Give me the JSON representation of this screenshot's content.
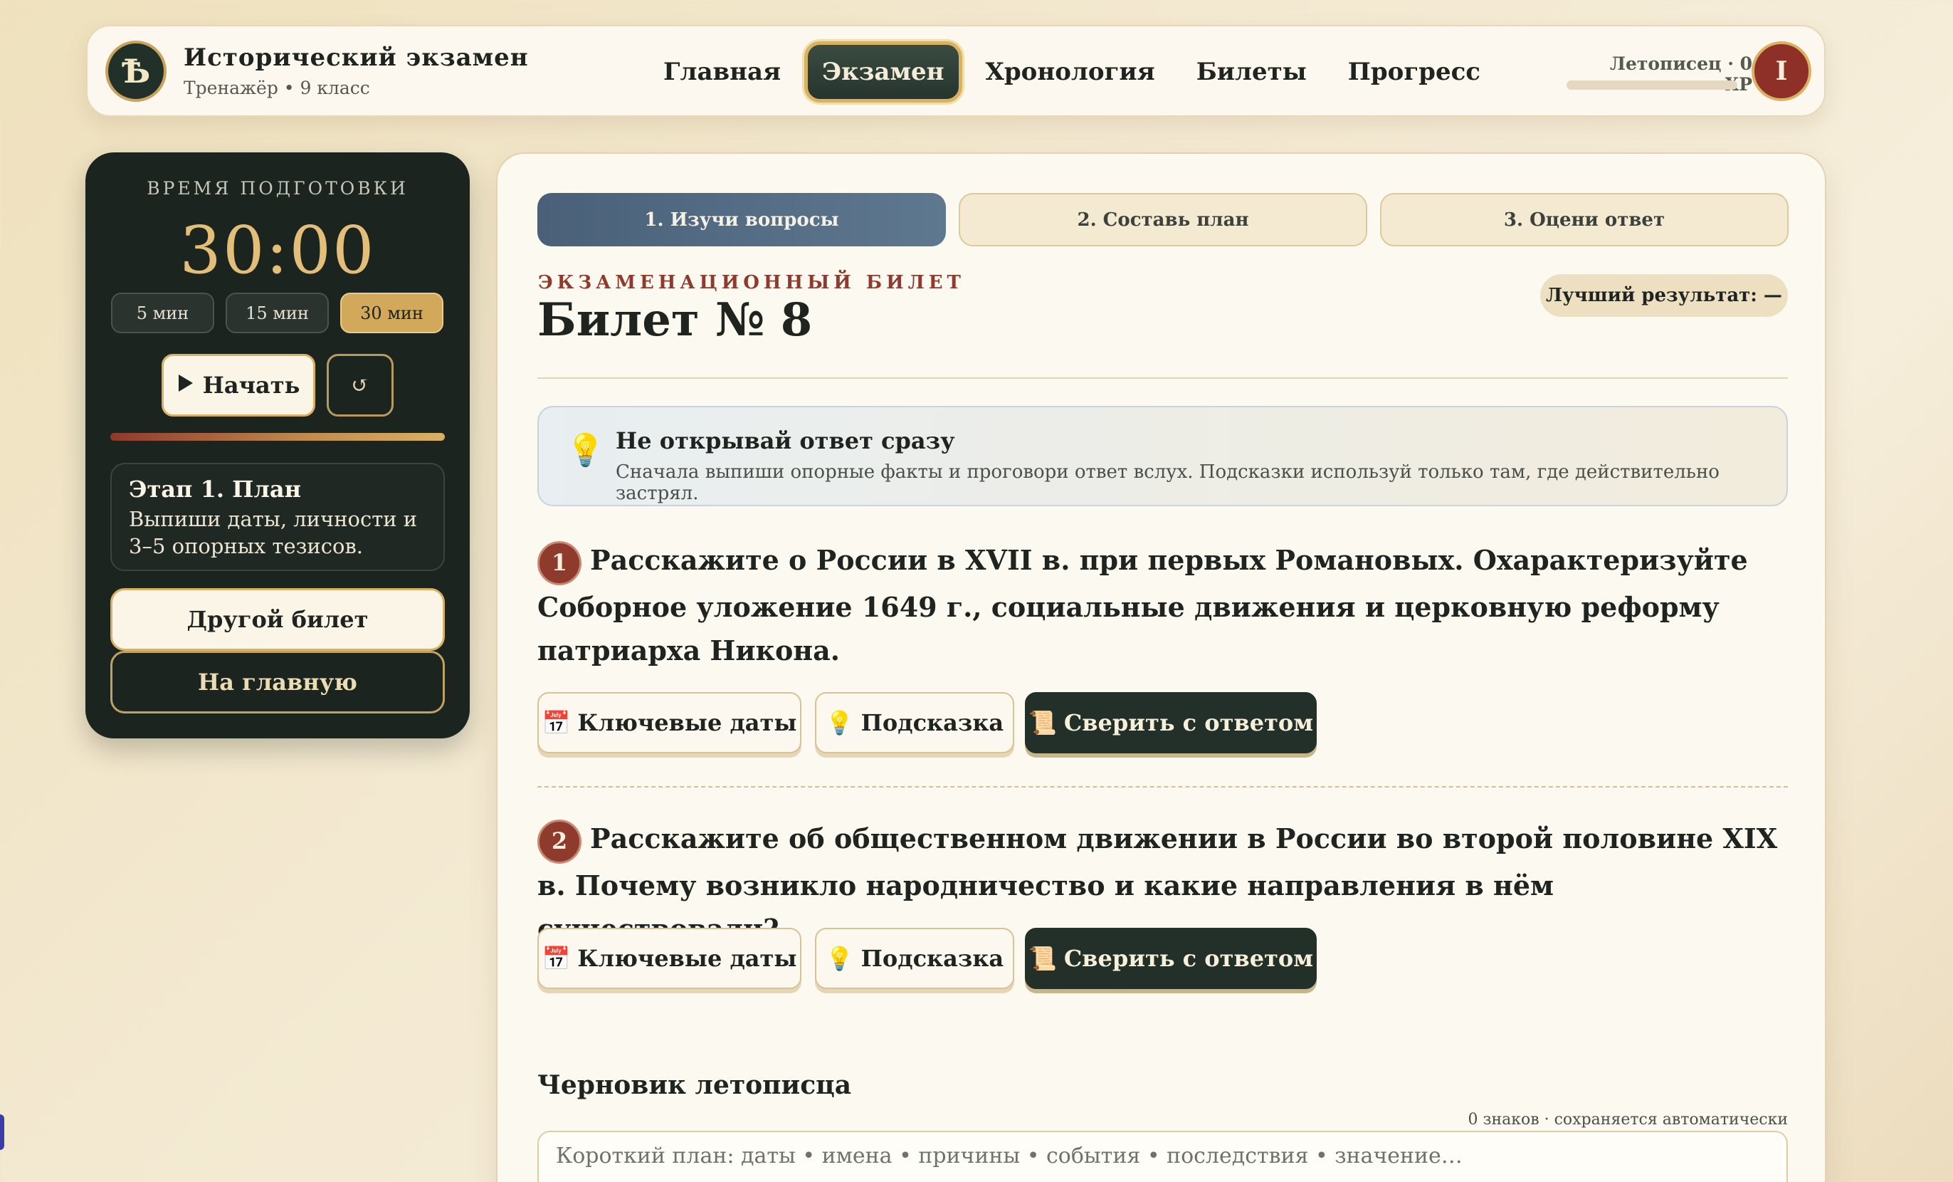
{
  "header": {
    "logo_glyph": "Ѣ",
    "title": "Исторический экзамен",
    "subtitle": "Тренажёр • 9 класс",
    "nav": [
      "Главная",
      "Экзамен",
      "Хронология",
      "Билеты",
      "Прогресс"
    ],
    "nav_active": "Экзамен",
    "xp_label": "Летописец · 0 XP",
    "xp_progress": 0,
    "avatar_letter": "I"
  },
  "sidebar": {
    "caption": "ВРЕМЯ ПОДГОТОВКИ",
    "timer": "30:00",
    "durations": [
      "5 мин",
      "15 мин",
      "30 мин"
    ],
    "duration_active": "30 мин",
    "start_label": "Начать",
    "reset_glyph": "↺",
    "stage_title": "Этап 1. План",
    "stage_text": "Выпиши даты, личности и 3–5 опорных тезисов.",
    "other_ticket": "Другой билет",
    "home": "На главную"
  },
  "main": {
    "steps": [
      "1. Изучи вопросы",
      "2. Составь план",
      "3. Оцени ответ"
    ],
    "step_active": "1. Изучи вопросы",
    "ticket_caption": "ЭКЗАМЕНАЦИОННЫЙ БИЛЕТ",
    "ticket_title": "Билет № 8",
    "best_result": "Лучший результат: —",
    "tip": {
      "title": "Не открывай ответ сразу",
      "text": "Сначала выпиши опорные факты и проговори ответ вслух. Подсказки используй только там, где действительно застрял."
    },
    "questions": [
      {
        "num": "1",
        "text": "Расскажите о России в XVII в. при первых Романовых. Охарактеризуйте Соборное уложение 1649 г., социальные движения и церковную реформу патриарха Никона."
      },
      {
        "num": "2",
        "text": "Расскажите об общественном движении в России во второй половине XIX в. Почему возникло народничество и какие направления в нём существовали?"
      }
    ],
    "buttons": {
      "dates": "Ключевые даты",
      "hint": "Подсказка",
      "check": "Сверить с ответом"
    },
    "draft": {
      "title": "Черновик летописца",
      "meta": "0 знаков · сохраняется автоматически",
      "placeholder": "Короткий план: даты • имена • причины • события • последствия • значение…"
    }
  }
}
